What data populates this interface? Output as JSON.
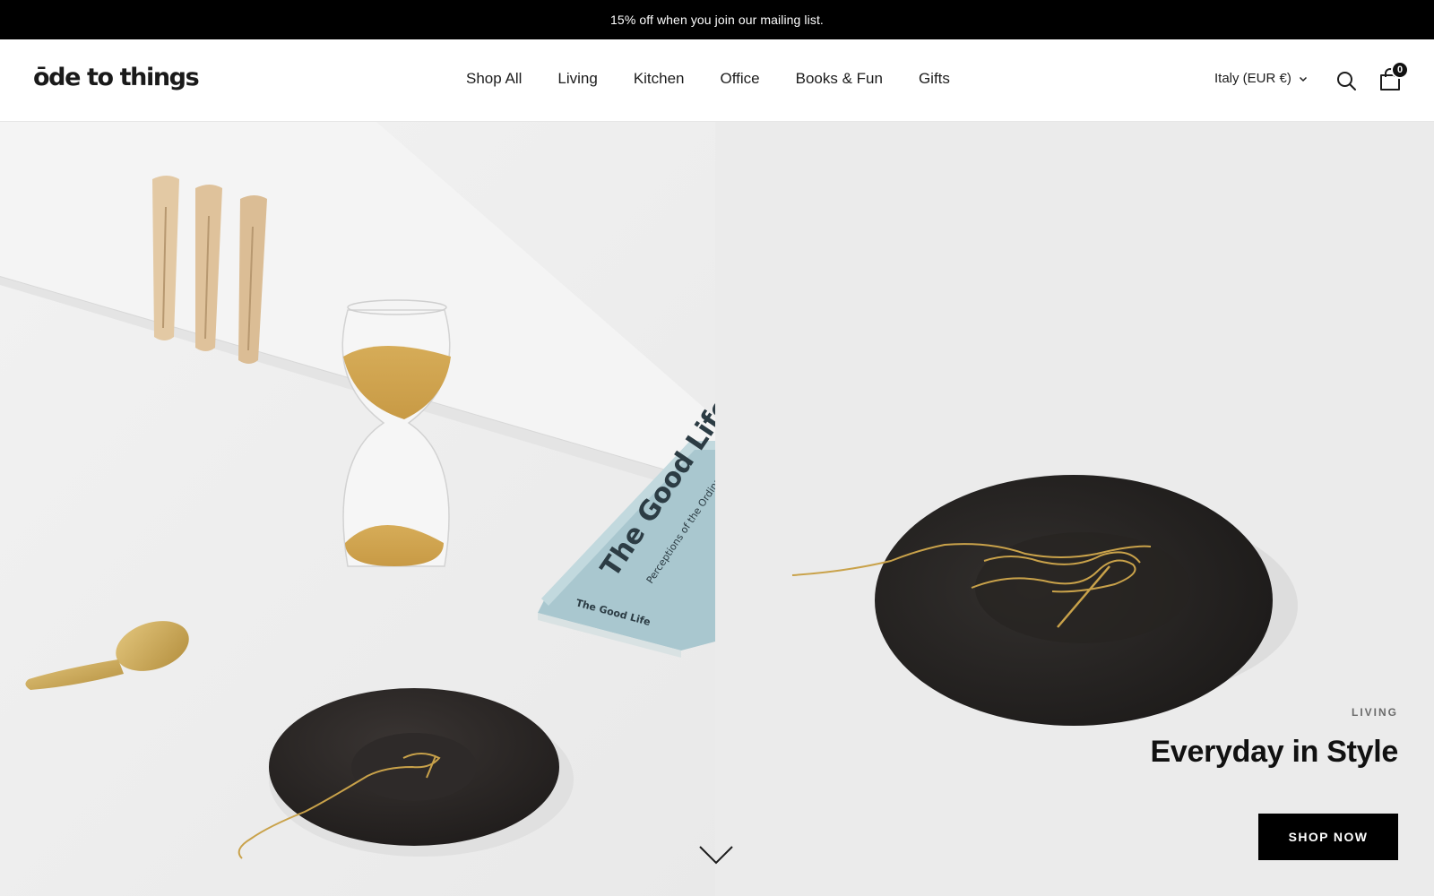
{
  "announcement": {
    "text": "15% off when you join our mailing list."
  },
  "header": {
    "logo": "ōde to things",
    "nav": [
      "Shop All",
      "Living",
      "Kitchen",
      "Office",
      "Books & Fun",
      "Gifts"
    ],
    "locale": "Italy (EUR €)",
    "cart_count": "0"
  },
  "hero": {
    "book_title": "The Good Life",
    "book_subtitle": "Perceptions of the Ordinary",
    "book_spine": "The Good Life",
    "eyebrow": "LIVING",
    "headline": "Everyday in Style",
    "cta": "SHOP NOW"
  },
  "icons": {
    "search": "search-icon",
    "cart": "cart-icon",
    "locale_chevron": "chevron-down-icon",
    "scroll": "chevron-down-icon"
  },
  "colors": {
    "announcement_bg": "#000000",
    "cta_bg": "#000000",
    "page_bg": "#ffffff",
    "hero_left_bg": "#efefef",
    "hero_right_bg": "#ebebeb"
  }
}
